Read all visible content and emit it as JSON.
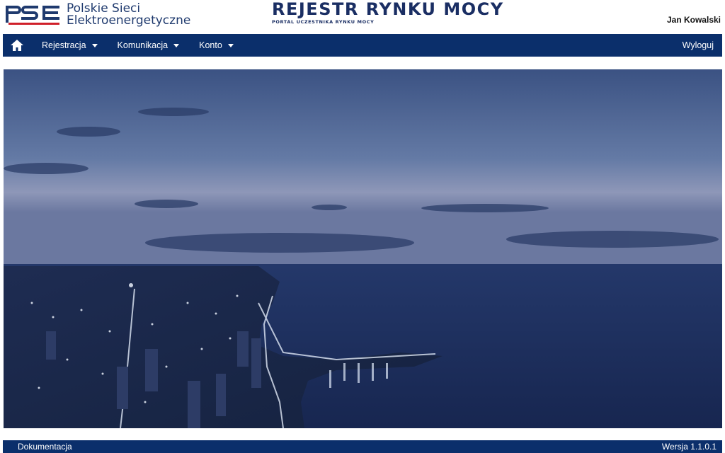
{
  "brand": {
    "logo_mark": "PSE",
    "company_line1": "Polskie Sieci",
    "company_line2": "Elektroenergetyczne"
  },
  "app": {
    "title": "REJESTR RYNKU MOCY",
    "subtitle": "PORTAL UCZESTNIKA RYNKU MOCY"
  },
  "user": {
    "name": "Jan Kowalski"
  },
  "nav": {
    "home_icon": "home-icon",
    "items": [
      {
        "label": "Rejestracja"
      },
      {
        "label": "Komunikacja"
      },
      {
        "label": "Konto"
      }
    ],
    "logout_label": "Wyloguj"
  },
  "footer": {
    "docs_label": "Dokumentacja",
    "version_label": "Wersja 1.1.0.1"
  },
  "colors": {
    "brand_navy": "#0b2f6b",
    "title_navy": "#1a2e63",
    "accent_red": "#d0202a"
  }
}
